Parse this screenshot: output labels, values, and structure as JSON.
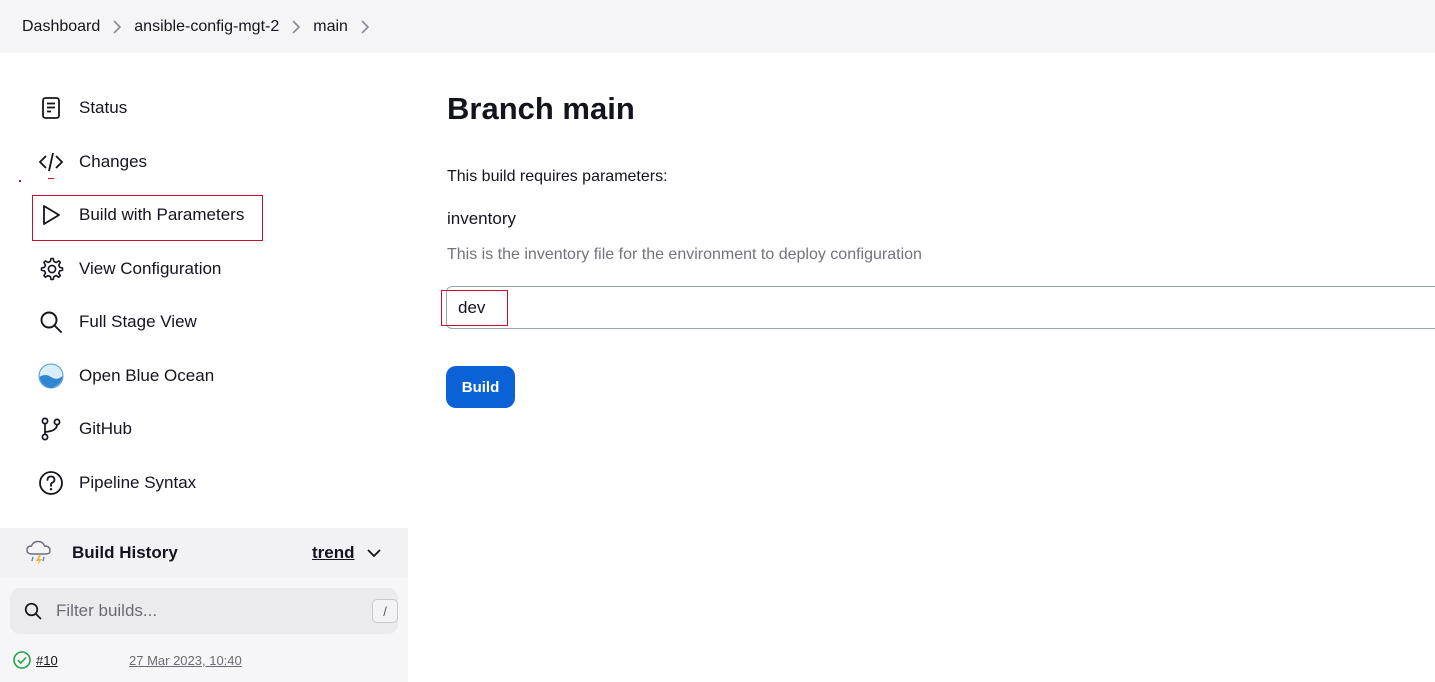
{
  "breadcrumb": {
    "items": [
      "Dashboard",
      "ansible-config-mgt-2",
      "main"
    ]
  },
  "sidebar": {
    "items": [
      {
        "label": "Status",
        "icon": "status-document-icon"
      },
      {
        "label": "Changes",
        "icon": "code-icon"
      },
      {
        "label": "Build with Parameters",
        "icon": "play-icon"
      },
      {
        "label": "View Configuration",
        "icon": "gear-icon"
      },
      {
        "label": "Full Stage View",
        "icon": "search-icon"
      },
      {
        "label": "Open Blue Ocean",
        "icon": "blue-ocean-icon"
      },
      {
        "label": "GitHub",
        "icon": "git-branch-icon"
      },
      {
        "label": "Pipeline Syntax",
        "icon": "help-circle-icon"
      }
    ]
  },
  "build_history": {
    "title": "Build History",
    "trend_label": "trend",
    "filter_placeholder": "Filter builds...",
    "shortcut_key": "/",
    "builds": [
      {
        "number": "#10",
        "date": "27 Mar 2023, 10:40",
        "status": "success"
      }
    ]
  },
  "main": {
    "title": "Branch main",
    "intro": "This build requires parameters:",
    "parameter": {
      "name": "inventory",
      "description": "This is the inventory file for the environment to deploy configuration",
      "value": "dev"
    },
    "build_button_label": "Build"
  },
  "colors": {
    "accent": "#0b62d6",
    "highlight": "#c8102e",
    "success": "#1ea446"
  }
}
